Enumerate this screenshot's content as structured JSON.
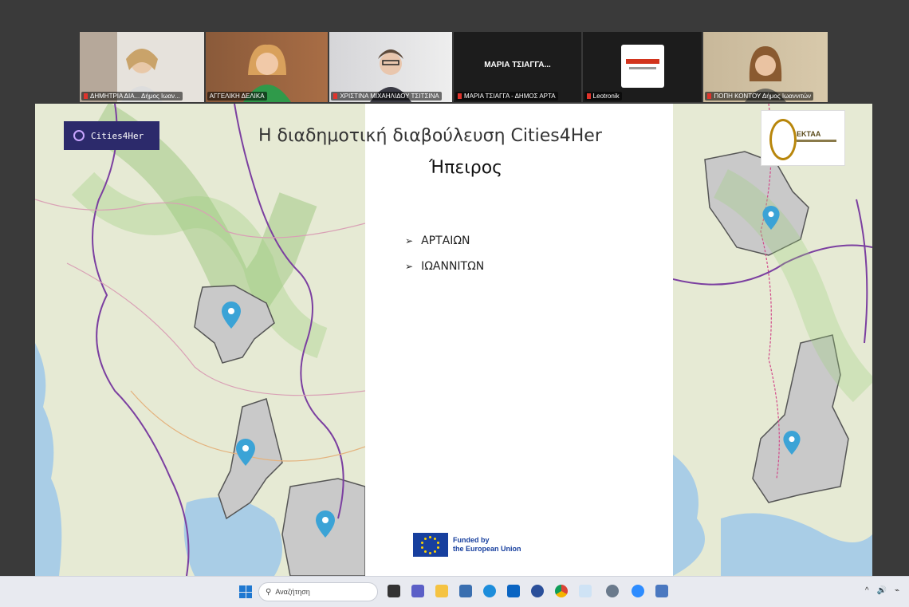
{
  "participants": [
    {
      "name": "ΔΗΜΗΤΡΙΑ ΔΙΑ... Δήμος Ιωαν...",
      "active": false
    },
    {
      "name": "ΑΓΓΕΛΙΚΗ ΔΕΛΙΚΑ",
      "active": true
    },
    {
      "name": "ΧΡΙΣΤΙΝΑ ΜΙΧΑΗΛΙΔΟΥ ΤΣΙΤΣΙΝΑ",
      "active": false
    },
    {
      "name": "ΜΑΡΙΑ ΤΣΙΑΓΓΑ - ΔΗΜΟΣ ΑΡΤΑ",
      "title": "ΜΑΡΙΑ ΤΣΙΑΓΓΑ...",
      "active": false
    },
    {
      "name": "Leotronik",
      "active": false
    },
    {
      "name": "ΠΟΠΗ ΚΟΝΤΟΥ Δήμος Ιωαννιτών",
      "active": false
    }
  ],
  "slide": {
    "logo_text": "Cities4Her",
    "title": "Η διαδημοτική διαβούλευση Cities4Her",
    "subtitle": "Ήπειρος",
    "bullets": [
      "ΑΡΤΑΙΩΝ",
      "ΙΩΑΝΝΙΤΩΝ"
    ],
    "funded_line1": "Funded by",
    "funded_line2": "the European Union",
    "ektaa_label": "ΕΚΤΑΑ"
  },
  "taskbar": {
    "search_placeholder": "Αναζήτηση",
    "tray_symbols": [
      "^",
      "🔊",
      "⌁"
    ]
  },
  "colors": {
    "accent_active": "#3fbf3f",
    "c4h_purple": "#2c2a6b",
    "eu_blue": "#173f9e",
    "pin_blue": "#3ba3d6"
  }
}
